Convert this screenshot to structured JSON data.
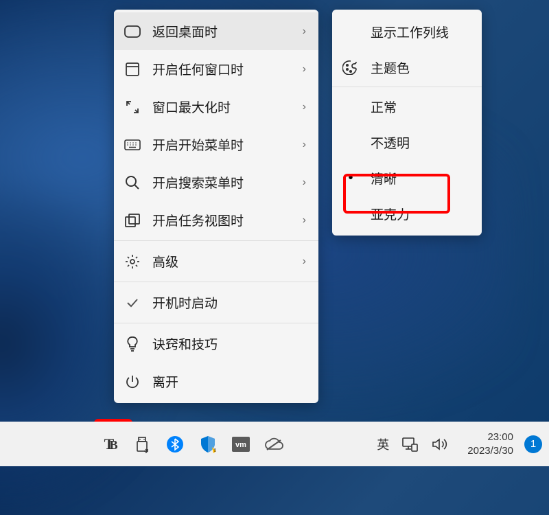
{
  "main_menu": {
    "items": [
      {
        "name": "return-desktop",
        "icon": "rounded-tab",
        "label": "返回桌面时",
        "arrow": true,
        "selected": true
      },
      {
        "name": "open-any-window",
        "icon": "square",
        "label": "开启任何窗口时",
        "arrow": true
      },
      {
        "name": "maximize-window",
        "icon": "expand",
        "label": "窗口最大化时",
        "arrow": true
      },
      {
        "name": "open-start-menu",
        "icon": "keyboard",
        "label": "开启开始菜单时",
        "arrow": true
      },
      {
        "name": "open-search-menu",
        "icon": "search",
        "label": "开启搜索菜单时",
        "arrow": true
      },
      {
        "name": "open-task-view",
        "icon": "task-view",
        "label": "开启任务视图时",
        "arrow": true
      }
    ],
    "advanced": {
      "name": "advanced",
      "icon": "gear",
      "label": "高级",
      "arrow": true
    },
    "startup": {
      "name": "startup",
      "icon": "check",
      "label": "开机时启动"
    },
    "bottom": [
      {
        "name": "tips",
        "icon": "bulb",
        "label": "诀窍和技巧"
      },
      {
        "name": "exit",
        "icon": "power",
        "label": "离开"
      }
    ]
  },
  "submenu": {
    "items": [
      {
        "name": "show-task-line",
        "label": "显示工作列线",
        "icon": null
      },
      {
        "name": "theme-color",
        "label": "主题色",
        "icon": "palette"
      },
      {
        "name": "normal",
        "label": "正常",
        "icon": null,
        "bullet": false
      },
      {
        "name": "opaque",
        "label": "不透明",
        "icon": null,
        "bullet": false
      },
      {
        "name": "clear",
        "label": "清晰",
        "icon": null,
        "bullet": true
      },
      {
        "name": "acrylic",
        "label": "亚克力",
        "icon": null,
        "bullet": false
      }
    ]
  },
  "taskbar": {
    "tray": [
      {
        "name": "tb-app",
        "type": "tb"
      },
      {
        "name": "usb",
        "type": "usb"
      },
      {
        "name": "bluetooth",
        "type": "bluetooth"
      },
      {
        "name": "security",
        "type": "security"
      },
      {
        "name": "vm",
        "type": "vm"
      },
      {
        "name": "cloud",
        "type": "cloud"
      }
    ],
    "ime": "英",
    "time": "23:00",
    "date": "2023/3/30",
    "notifications": "1"
  }
}
